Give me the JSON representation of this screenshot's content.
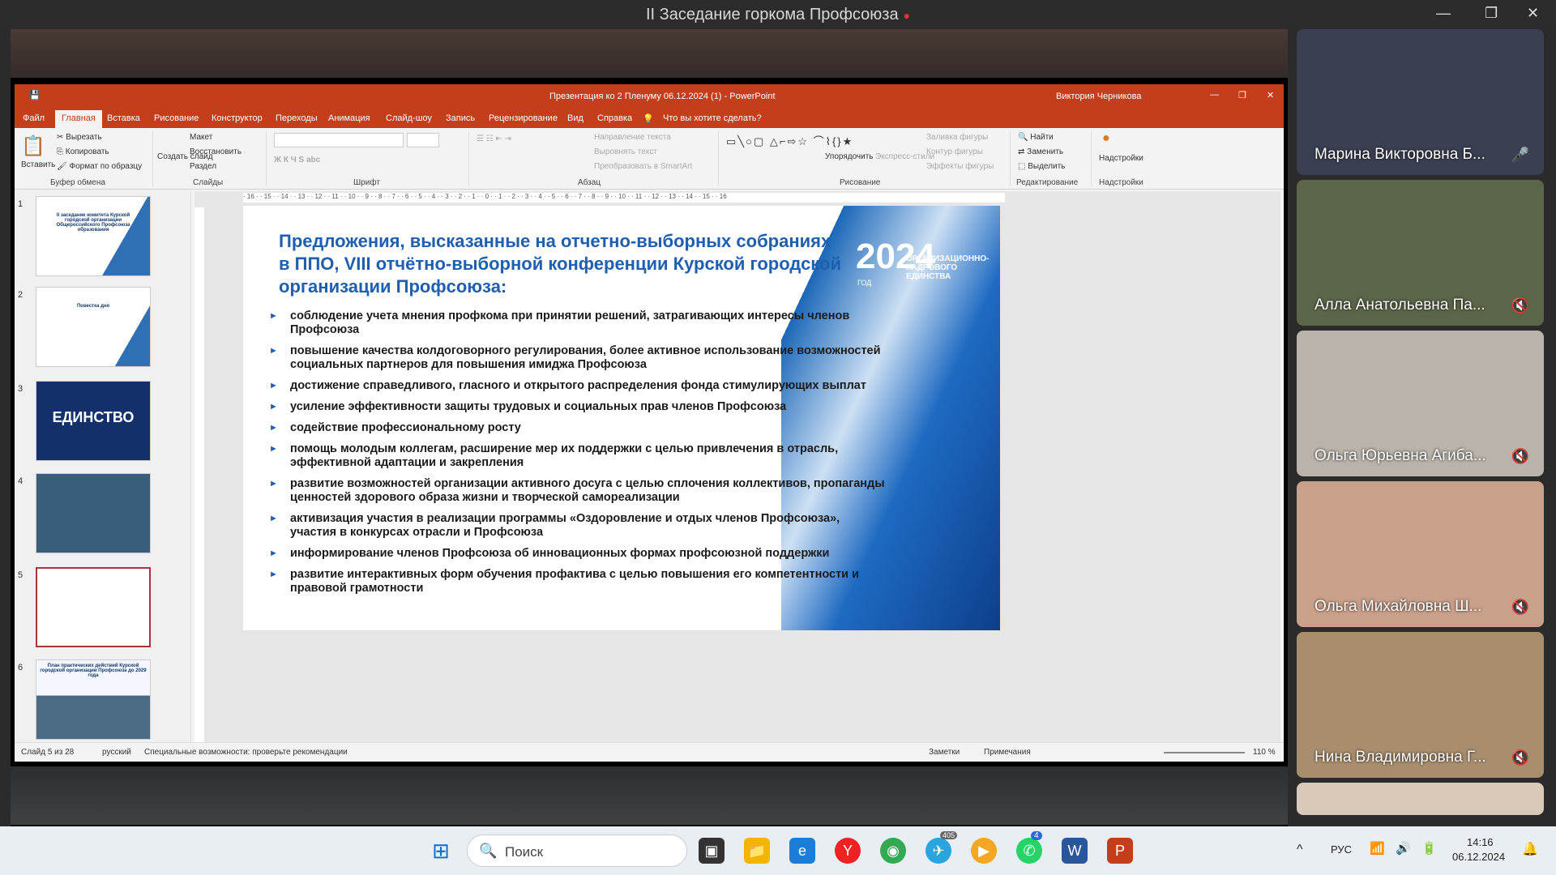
{
  "window": {
    "title": "II Заседание горкома Профсоюза",
    "recording_dot": "●",
    "min": "—",
    "restore": "❐",
    "close": "✕"
  },
  "ppt": {
    "title": "Презентация ко 2 Пленуму 06.12.2024 (1)  -  PowerPoint",
    "user": "Виктория Черникова",
    "tabs": [
      "Файл",
      "Главная",
      "Вставка",
      "Рисование",
      "Конструктор",
      "Переходы",
      "Анимация",
      "Слайд-шоу",
      "Запись",
      "Рецензирование",
      "Вид",
      "Справка"
    ],
    "tell_me": "Что вы хотите сделать?",
    "ribbon": {
      "paste": "Вставить",
      "cut": "Вырезать",
      "copy": "Копировать",
      "format_painter": "Формат по образцу",
      "g_clipboard": "Буфер обмена",
      "new_slide": "Создать слайд",
      "layout": "Макет",
      "reset": "Восстановить",
      "section": "Раздел",
      "g_slides": "Слайды",
      "g_font": "Шрифт",
      "text_dir": "Направление текста",
      "align_text": "Выровнять текст",
      "smartart": "Преобразовать в SmartArt",
      "g_para": "Абзац",
      "arrange": "Упорядочить",
      "quick_styles": "Экспресс-стили",
      "fill": "Заливка фигуры",
      "outline": "Контур фигуры",
      "effects": "Эффекты фигуры",
      "g_draw": "Рисование",
      "find": "Найти",
      "replace": "Заменить",
      "select": "Выделить",
      "g_edit": "Редактирование",
      "addins": "Надстройки",
      "g_addins": "Надстройки"
    },
    "thumbs": [
      {
        "n": "1",
        "text": "II заседание комитета Курской городской организации Общероссийского Профсоюза образования"
      },
      {
        "n": "2",
        "text": "Повестка дня"
      },
      {
        "n": "3",
        "text": "ЕДИНСТВО"
      },
      {
        "n": "4",
        "text": ""
      },
      {
        "n": "5",
        "text": ""
      },
      {
        "n": "6",
        "text": "План практических действий Курской городской организации Профсоюза до 2029 года"
      }
    ],
    "ruler": "· 16 · · 15 · · 14 · · 13 · · 12 · · 11 · · 10 · · 9 · · 8 · · 7 · · 6 · · 5 · · 4 · · 3 · · 2 · · 1 · · 0 · · 1 · · 2 · · 3 · · 4 · · 5 · · 6 · · 7 · · 8 · · 9 · · 10 · · 11 · · 12 · · 13 · · 14 · · 15 · · 16",
    "slide": {
      "title": "Предложения, высказанные на отчетно-выборных собраниях в ППО, VIII отчётно-выборной конференции Курской городской организации Профсоюза:",
      "logo_year": "2024",
      "logo_god": "ГОД",
      "logo_org": "ОРГАНИЗАЦИОННО-КАДРОВОГО ЕДИНСТВА",
      "bullets": [
        "соблюдение учета мнения профкома при принятии решений, затрагивающих интересы членов Профсоюза",
        "повышение качества колдоговорного регулирования, более активное использование возможностей социальных партнеров для повышения имиджа Профсоюза",
        "достижение справедливого, гласного и открытого распределения фонда стимулирующих выплат",
        "усиление эффективности защиты трудовых и социальных прав членов Профсоюза",
        "содействие профессиональному росту",
        "помощь молодым коллегам, расширение мер их поддержки с целью привлечения в отрасль, эффективной адаптации и закрепления",
        "развитие возможностей организации активного досуга с целью сплочения коллективов, пропаганды ценностей здорового образа жизни и творческой самореализации",
        "активизация участия в реализации программы «Оздоровление и отдых членов Профсоюза», участия в конкурсах отрасли и Профсоюза",
        "информирование членов Профсоюза об инновационных формах профсоюзной поддержки",
        "развитие интерактивных форм обучения профактива с целью повышения его компетентности и правовой грамотности"
      ]
    },
    "status": {
      "slide": "Слайд 5 из 28",
      "lang": "русский",
      "access": "Специальные возможности: проверьте рекомендации",
      "notes": "Заметки",
      "comments": "Примечания",
      "zoom": "110 %"
    }
  },
  "participants": [
    {
      "name": "Марина Викторовна Б...",
      "muted": false,
      "bg": "#3a3f52"
    },
    {
      "name": "Алла Анатольевна Па...",
      "muted": true,
      "bg": "#5b6648"
    },
    {
      "name": "Ольга Юрьевна Агиба...",
      "muted": true,
      "bg": "#b9b3a9"
    },
    {
      "name": "Ольга Михайловна Ш...",
      "muted": true,
      "bg": "#c9a08a"
    },
    {
      "name": "Нина Владимировна Г...",
      "muted": true,
      "bg": "#a98e6e"
    }
  ],
  "taskbar": {
    "search": "Поиск",
    "lang": "РУС",
    "time": "14:16",
    "date": "06.12.2024",
    "telegram_badge": "405",
    "whatsapp_badge": "4"
  }
}
